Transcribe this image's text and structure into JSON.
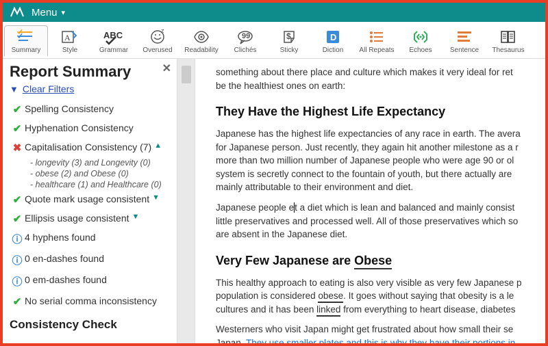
{
  "menubar": {
    "menu_label": "Menu"
  },
  "toolbar": {
    "items": [
      {
        "label": "Summary"
      },
      {
        "label": "Style"
      },
      {
        "label": "Grammar"
      },
      {
        "label": "Overused"
      },
      {
        "label": "Readability"
      },
      {
        "label": "Clichés"
      },
      {
        "label": "Sticky"
      },
      {
        "label": "Diction"
      },
      {
        "label": "All Repeats"
      },
      {
        "label": "Echoes"
      },
      {
        "label": "Sentence"
      },
      {
        "label": "Thesaurus"
      }
    ]
  },
  "sidebar": {
    "title": "Report Summary",
    "clear_filters": "Clear Filters",
    "items": [
      {
        "status": "ok",
        "text": "Spelling Consistency"
      },
      {
        "status": "ok",
        "text": "Hyphenation Consistency"
      },
      {
        "status": "err",
        "text": "Capitalisation Consistency (7)",
        "expanded": true,
        "sub": [
          "- longevity (3) and Longevity (0)",
          "- obese (2) and Obese (0)",
          "- healthcare (1) and Healthcare (0)"
        ]
      },
      {
        "status": "ok",
        "text": "Quote mark usage consistent",
        "collapsible": true
      },
      {
        "status": "ok",
        "text": "Ellipsis usage consistent",
        "collapsible": true
      },
      {
        "status": "info",
        "text": "4 hyphens found"
      },
      {
        "status": "info",
        "text": "0 en-dashes found"
      },
      {
        "status": "info",
        "text": "0 em-dashes found"
      },
      {
        "status": "ok",
        "text": "No serial comma inconsistency"
      }
    ],
    "section2": "Consistency Check"
  },
  "doc": {
    "p0a": "something about there place and culture which makes it very ideal for ret",
    "p0b": "be the healthiest ones on earth:",
    "h1": "They Have the Highest Life Expectancy",
    "p1": "Japanese has the highest life expectancies of any race in earth. The avera",
    "p2": "for Japanese person. Just recently, they again hit another milestone as a r",
    "p3": "more than two million number of Japanese people who were age 90 or ol",
    "p4": "system is secretly connect to the fountain of youth, but there actually are",
    "p5": "mainly attributable to their environment and diet.",
    "p6a": "Japanese people e",
    "p6b": "t a diet which is lean and balanced and mainly consist",
    "p7": "little preservatives and processed well. All of those preservatives which so",
    "p8": "are absent in the Japanese diet.",
    "h2a": "Very Few Japanese are ",
    "h2b": "Obese",
    "p9": "This healthy approach to eating is also very visible as very few Japanese p",
    "p10a": "population is considered ",
    "p10b": "obese",
    "p10c": ". It goes without saying that obesity is a le",
    "p11a": "cultures and it has been ",
    "p11b": "linked",
    "p11c": " from everything to heart disease, diabetes",
    "p12": "Westerners who visit Japan might get frustrated about how small their se",
    "p13a": "Japan. ",
    "p13b": "They use smaller plates and this is why they have their portions in"
  }
}
